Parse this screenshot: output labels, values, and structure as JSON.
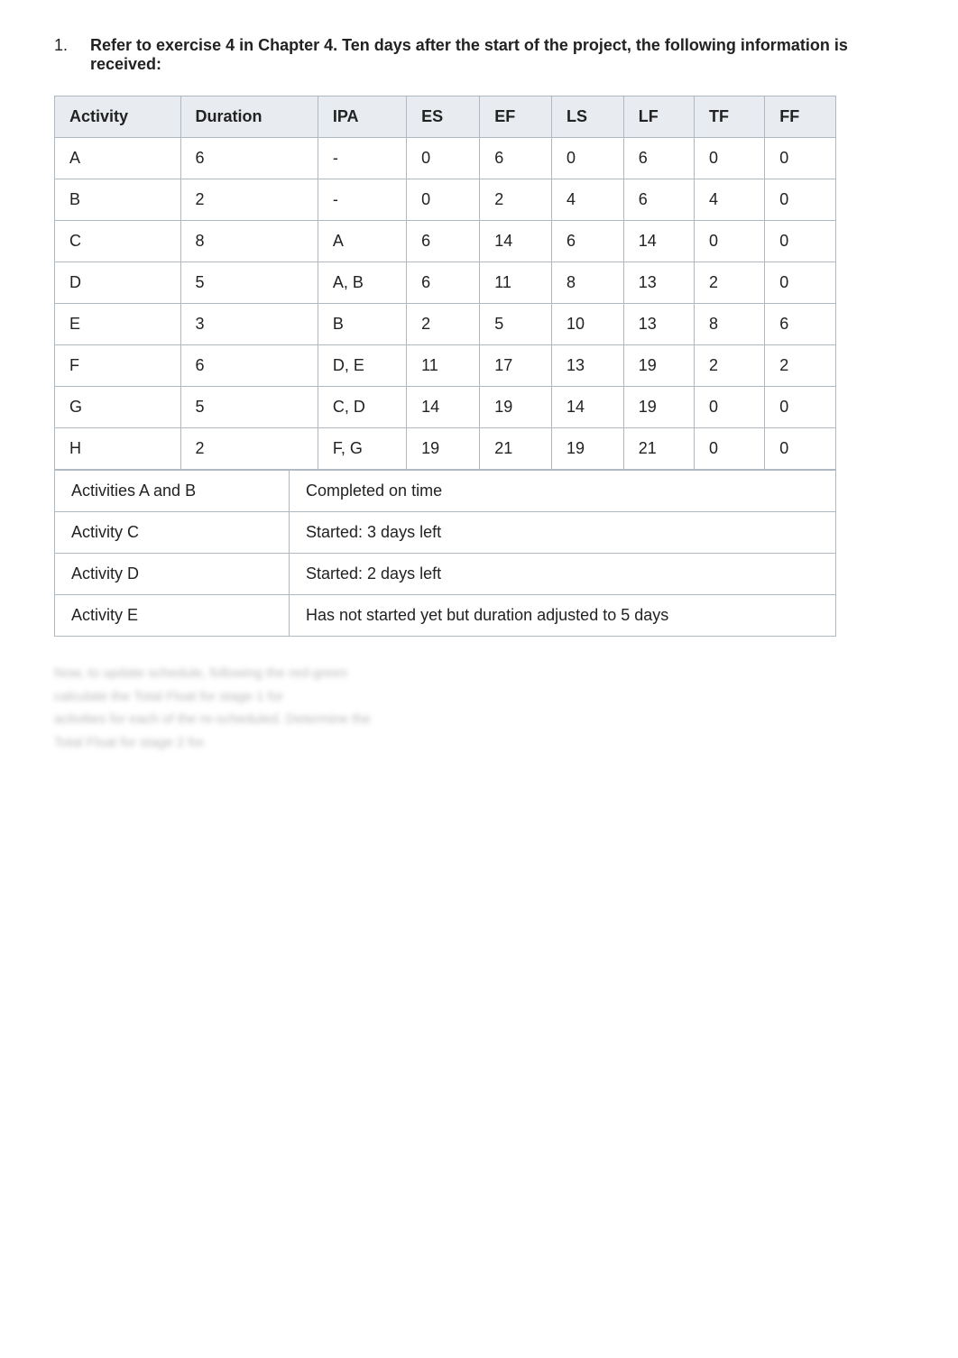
{
  "question": {
    "number": "1.",
    "text": "Refer to exercise 4 in Chapter 4. Ten days after the start of the project, the following information is received:"
  },
  "table": {
    "headers": [
      "Activity",
      "Duration",
      "IPA",
      "ES",
      "EF",
      "LS",
      "LF",
      "TF",
      "FF"
    ],
    "rows": [
      [
        "A",
        "6",
        "-",
        "0",
        "6",
        "0",
        "6",
        "0",
        "0"
      ],
      [
        "B",
        "2",
        "-",
        "0",
        "2",
        "4",
        "6",
        "4",
        "0"
      ],
      [
        "C",
        "8",
        "A",
        "6",
        "14",
        "6",
        "14",
        "0",
        "0"
      ],
      [
        "D",
        "5",
        "A, B",
        "6",
        "11",
        "8",
        "13",
        "2",
        "0"
      ],
      [
        "E",
        "3",
        "B",
        "2",
        "5",
        "10",
        "13",
        "8",
        "6"
      ],
      [
        "F",
        "6",
        "D, E",
        "11",
        "17",
        "13",
        "19",
        "2",
        "2"
      ],
      [
        "G",
        "5",
        "C, D",
        "14",
        "19",
        "14",
        "19",
        "0",
        "0"
      ],
      [
        "H",
        "2",
        "F, G",
        "19",
        "21",
        "19",
        "21",
        "0",
        "0"
      ]
    ]
  },
  "status": {
    "rows": [
      [
        "Activities A and B",
        "Completed on time"
      ],
      [
        "Activity C",
        "Started: 3 days left"
      ],
      [
        "Activity D",
        "Started: 2 days left"
      ],
      [
        "Activity E",
        "Has not started yet but duration adjusted to 5 days"
      ]
    ]
  },
  "blurred_lines": [
    "Now, to update schedule, following the red-green",
    "calculate the Total Float for stage 1 for",
    "activities for each of the re-scheduled. Determine the",
    "Total Float for stage 2 for."
  ]
}
